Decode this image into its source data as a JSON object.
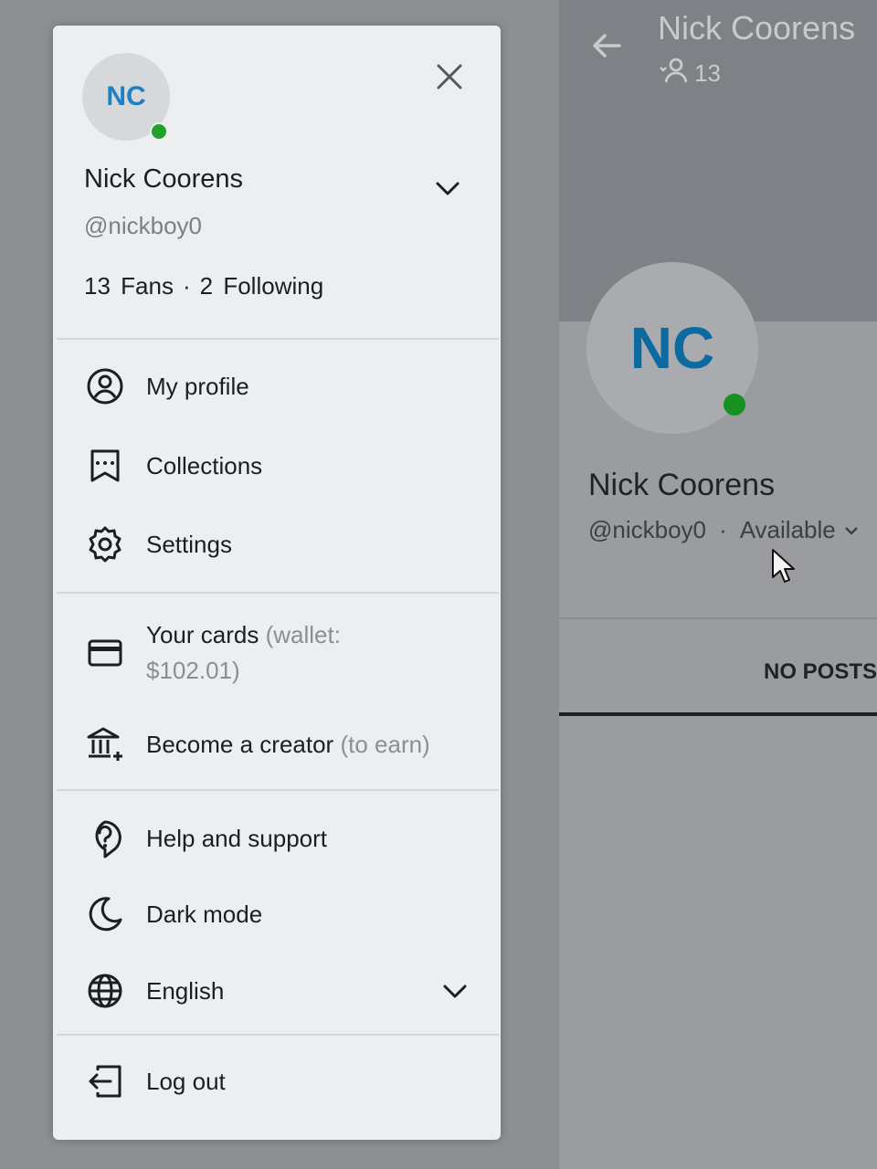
{
  "profile_page": {
    "title": "Nick Coorens",
    "fans_count": "13",
    "avatar_initials": "NC",
    "name": "Nick Coorens",
    "handle": "@nickboy0",
    "status": "Available",
    "tab": "NO POSTS"
  },
  "drawer": {
    "avatar_initials": "NC",
    "name": "Nick Coorens",
    "handle": "@nickboy0",
    "fans": {
      "count": "13",
      "label": "Fans"
    },
    "following": {
      "count": "2",
      "label": "Following"
    },
    "menu": [
      {
        "label": "My profile",
        "icon": "user-circle-icon"
      },
      {
        "label": "Collections",
        "icon": "bookmark-stars-icon"
      },
      {
        "label": "Settings",
        "icon": "gear-icon"
      },
      {
        "label": "Your cards",
        "extra": "(wallet: $102.01)",
        "icon": "card-icon"
      },
      {
        "label": "Become a creator",
        "extra": "(to earn)",
        "icon": "bank-plus-icon"
      },
      {
        "label": "Help and support",
        "icon": "question-bubble-icon"
      },
      {
        "label": "Dark mode",
        "icon": "moon-icon"
      },
      {
        "label": "English",
        "icon": "globe-icon"
      },
      {
        "label": "Log out",
        "icon": "logout-icon"
      }
    ]
  },
  "colors": {
    "accent": "#1a82c4",
    "online": "#22a02c",
    "text": "#1c1e21",
    "muted": "#8b8f94"
  }
}
